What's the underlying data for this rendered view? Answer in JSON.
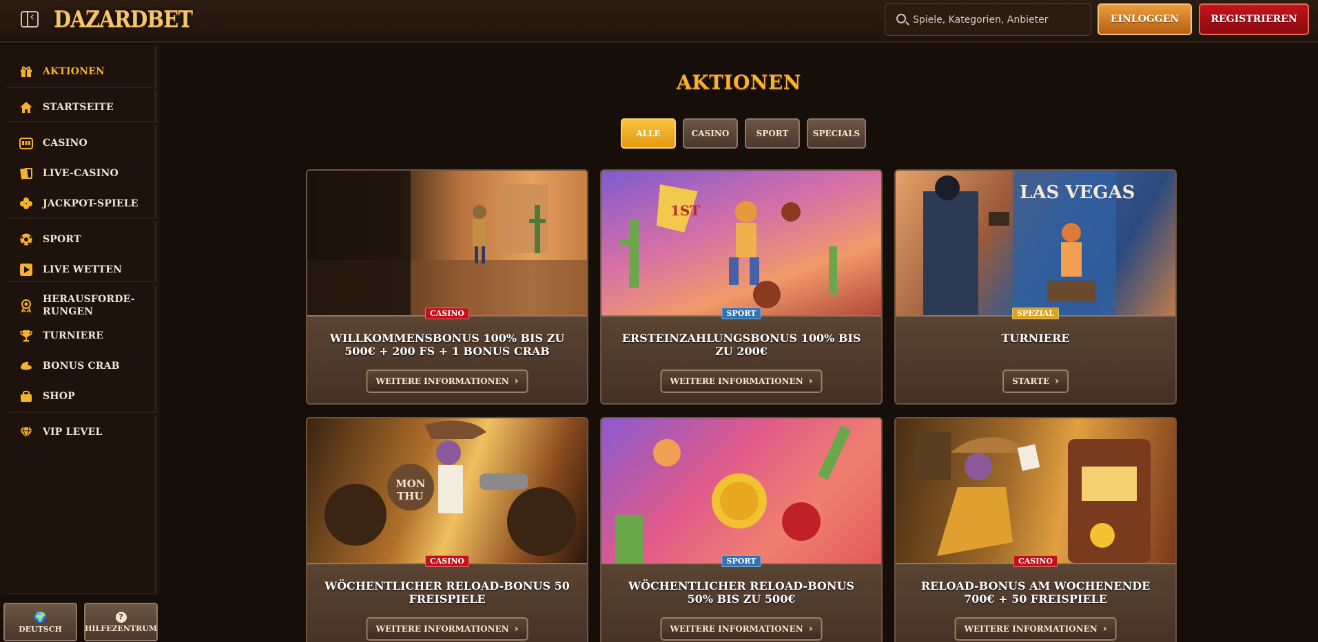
{
  "header": {
    "logo": "DAZARDBET",
    "search_placeholder": "Spiele, Kategorien, Anbieter",
    "login_label": "EINLOGGEN",
    "register_label": "REGISTRIEREN"
  },
  "sidebar": {
    "items": [
      {
        "label": "AKTIONEN",
        "icon": "gift-icon"
      },
      {
        "label": "STARTSEITE",
        "icon": "home-icon"
      },
      {
        "label": "CASINO",
        "icon": "slot-machine-icon"
      },
      {
        "label": "LIVE-CASINO",
        "icon": "cards-icon"
      },
      {
        "label": "JACKPOT-SPIELE",
        "icon": "clover-icon"
      },
      {
        "label": "SPORT",
        "icon": "soccer-ball-icon"
      },
      {
        "label": "LIVE WETTEN",
        "icon": "play-icon"
      },
      {
        "label": "HERAUSFORDE-",
        "label2": "RUNGEN",
        "icon": "medal-icon"
      },
      {
        "label": "TURNIERE",
        "icon": "trophy-icon"
      },
      {
        "label": "BONUS CRAB",
        "icon": "crab-icon"
      },
      {
        "label": "SHOP",
        "icon": "shopping-bag-icon"
      },
      {
        "label": "VIP LEVEL",
        "icon": "diamond-icon"
      }
    ],
    "language_label": "DEUTSCH",
    "help_label": "HILFEZENTRUM"
  },
  "main": {
    "title": "AKTIONEN",
    "filters": [
      "ALLE",
      "CASINO",
      "SPORT",
      "SPECIALS"
    ],
    "cards": [
      {
        "badge": "CASINO",
        "title": "WILLKOMMENSBONUS 100% BIS ZU 500€ + 200 FS + 1 BONUS CRAB",
        "button": "WEITERE INFORMATIONEN"
      },
      {
        "badge": "SPORT",
        "title": "ERSTEINZAHLUNGSBONUS 100% BIS ZU 200€",
        "button": "WEITERE INFORMATIONEN"
      },
      {
        "badge": "SPEZIAL",
        "title": "TURNIERE",
        "button": "STARTE"
      },
      {
        "badge": "CASINO",
        "title": "WÖCHENTLICHER RELOAD-BONUS 50 FREISPIELE",
        "button": "WEITERE INFORMATIONEN"
      },
      {
        "badge": "SPORT",
        "title": "WÖCHENTLICHER RELOAD-BONUS 50% BIS ZU 500€",
        "button": "WEITERE INFORMATIONEN"
      },
      {
        "badge": "CASINO",
        "title": "RELOAD-BONUS AM WOCHENENDE 700€ + 50 FREISPIELE",
        "button": "WEITERE INFORMATIONEN"
      }
    ]
  },
  "colors": {
    "accent": "#f7b22c",
    "background": "#150e09",
    "login": "#d47a24",
    "register": "#b3101a"
  }
}
